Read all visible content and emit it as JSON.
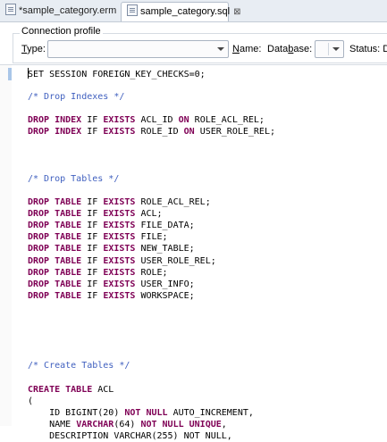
{
  "tabs": [
    {
      "label": "*sample_category.erm",
      "icon": "erm-file-icon",
      "active": false
    },
    {
      "label": "sample_category.sql",
      "icon": "sql-file-icon",
      "active": true,
      "close": "⊠"
    }
  ],
  "profile": {
    "title": "Connection profile",
    "type_label_u": "T",
    "type_label_rest": "ype:",
    "type_value": "",
    "name_label_u": "N",
    "name_label_rest": "ame:",
    "database_label_a": "Data",
    "database_label_u": "b",
    "database_label_rest": "ase:",
    "database_value": "",
    "status_label": "Status: D"
  },
  "code": [
    [
      [
        "t",
        "SET SESSION FOREIGN_KEY_CHECKS=0;"
      ]
    ],
    [],
    [
      [
        "c",
        "/* Drop Indexes */"
      ]
    ],
    [],
    [
      [
        "k",
        "DROP INDEX"
      ],
      [
        "t",
        " IF "
      ],
      [
        "k",
        "EXISTS"
      ],
      [
        "t",
        " ACL_ID "
      ],
      [
        "k",
        "ON"
      ],
      [
        "t",
        " ROLE_ACL_REL;"
      ]
    ],
    [
      [
        "k",
        "DROP INDEX"
      ],
      [
        "t",
        " IF "
      ],
      [
        "k",
        "EXISTS"
      ],
      [
        "t",
        " ROLE_ID "
      ],
      [
        "k",
        "ON"
      ],
      [
        "t",
        " USER_ROLE_REL;"
      ]
    ],
    [],
    [],
    [],
    [
      [
        "c",
        "/* Drop Tables */"
      ]
    ],
    [],
    [
      [
        "k",
        "DROP TABLE"
      ],
      [
        "t",
        " IF "
      ],
      [
        "k",
        "EXISTS"
      ],
      [
        "t",
        " ROLE_ACL_REL;"
      ]
    ],
    [
      [
        "k",
        "DROP TABLE"
      ],
      [
        "t",
        " IF "
      ],
      [
        "k",
        "EXISTS"
      ],
      [
        "t",
        " ACL;"
      ]
    ],
    [
      [
        "k",
        "DROP TABLE"
      ],
      [
        "t",
        " IF "
      ],
      [
        "k",
        "EXISTS"
      ],
      [
        "t",
        " FILE_DATA;"
      ]
    ],
    [
      [
        "k",
        "DROP TABLE"
      ],
      [
        "t",
        " IF "
      ],
      [
        "k",
        "EXISTS"
      ],
      [
        "t",
        " FILE;"
      ]
    ],
    [
      [
        "k",
        "DROP TABLE"
      ],
      [
        "t",
        " IF "
      ],
      [
        "k",
        "EXISTS"
      ],
      [
        "t",
        " NEW_TABLE;"
      ]
    ],
    [
      [
        "k",
        "DROP TABLE"
      ],
      [
        "t",
        " IF "
      ],
      [
        "k",
        "EXISTS"
      ],
      [
        "t",
        " USER_ROLE_REL;"
      ]
    ],
    [
      [
        "k",
        "DROP TABLE"
      ],
      [
        "t",
        " IF "
      ],
      [
        "k",
        "EXISTS"
      ],
      [
        "t",
        " ROLE;"
      ]
    ],
    [
      [
        "k",
        "DROP TABLE"
      ],
      [
        "t",
        " IF "
      ],
      [
        "k",
        "EXISTS"
      ],
      [
        "t",
        " USER_INFO;"
      ]
    ],
    [
      [
        "k",
        "DROP TABLE"
      ],
      [
        "t",
        " IF "
      ],
      [
        "k",
        "EXISTS"
      ],
      [
        "t",
        " WORKSPACE;"
      ]
    ],
    [],
    [],
    [],
    [],
    [],
    [
      [
        "c",
        "/* Create Tables */"
      ]
    ],
    [],
    [
      [
        "k",
        "CREATE TABLE"
      ],
      [
        "t",
        " ACL"
      ]
    ],
    [
      [
        "t",
        "("
      ]
    ],
    [
      [
        "t",
        "    ID BIGINT(20) "
      ],
      [
        "k",
        "NOT NULL"
      ],
      [
        "t",
        " AUTO_INCREMENT,"
      ]
    ],
    [
      [
        "t",
        "    NAME "
      ],
      [
        "k",
        "VARCHAR"
      ],
      [
        "t",
        "(64) "
      ],
      [
        "k",
        "NOT NULL UNIQUE"
      ],
      [
        "t",
        ","
      ]
    ],
    [
      [
        "t",
        "    DESCRIPTION VARCHAR(255) NOT NULL,"
      ]
    ]
  ]
}
